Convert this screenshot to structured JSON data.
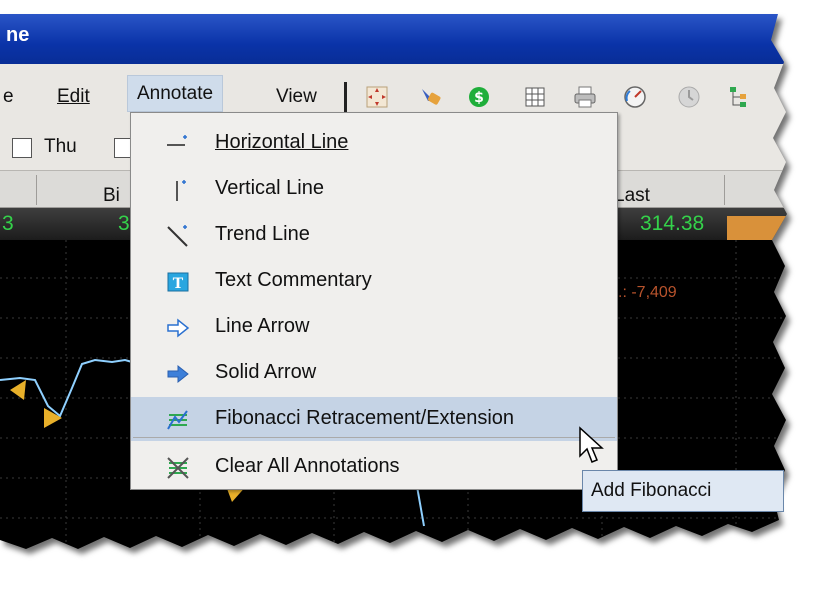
{
  "window": {
    "title_fragment": "ne"
  },
  "menu_bar": {
    "items": [
      {
        "label": "e"
      },
      {
        "label": "Edit"
      },
      {
        "label": "Annotate"
      },
      {
        "label": "View"
      }
    ]
  },
  "toolbar_icons": [
    "crosshair-icon",
    "cursor-paint-icon",
    "dollar-circle-icon",
    "grid-icon",
    "printer-icon",
    "speed-gauge-icon",
    "clock-icon",
    "tree-icon"
  ],
  "filter_row": {
    "checkbox_label": "Thu"
  },
  "table": {
    "headers": {
      "bid": "Bi",
      "last": "Last"
    },
    "row": {
      "left_value": "3",
      "bid_value": "3",
      "last_value": "314.38"
    }
  },
  "chart": {
    "readout": ".: -7,409"
  },
  "annotate_menu": {
    "items": [
      {
        "label": "Horizontal Line",
        "icon": "horizontal-line-icon"
      },
      {
        "label": "Vertical Line",
        "icon": "vertical-line-icon"
      },
      {
        "label": "Trend Line",
        "icon": "trend-line-icon"
      },
      {
        "label": "Text Commentary",
        "icon": "text-commentary-icon"
      },
      {
        "label": "Line Arrow",
        "icon": "line-arrow-icon"
      },
      {
        "label": "Solid Arrow",
        "icon": "solid-arrow-icon"
      },
      {
        "label": "Fibonacci Retracement/Extension",
        "icon": "fibonacci-icon"
      },
      {
        "label": "Clear All Annotations",
        "icon": "clear-annotations-icon"
      }
    ],
    "highlighted_index": 6
  },
  "tooltip": {
    "text": "Add Fibonacci"
  },
  "colors": {
    "title_blue": "#0a33a8",
    "green_value": "#34d24a",
    "accent_orange": "#d9913a",
    "chart_bg": "#000000"
  }
}
